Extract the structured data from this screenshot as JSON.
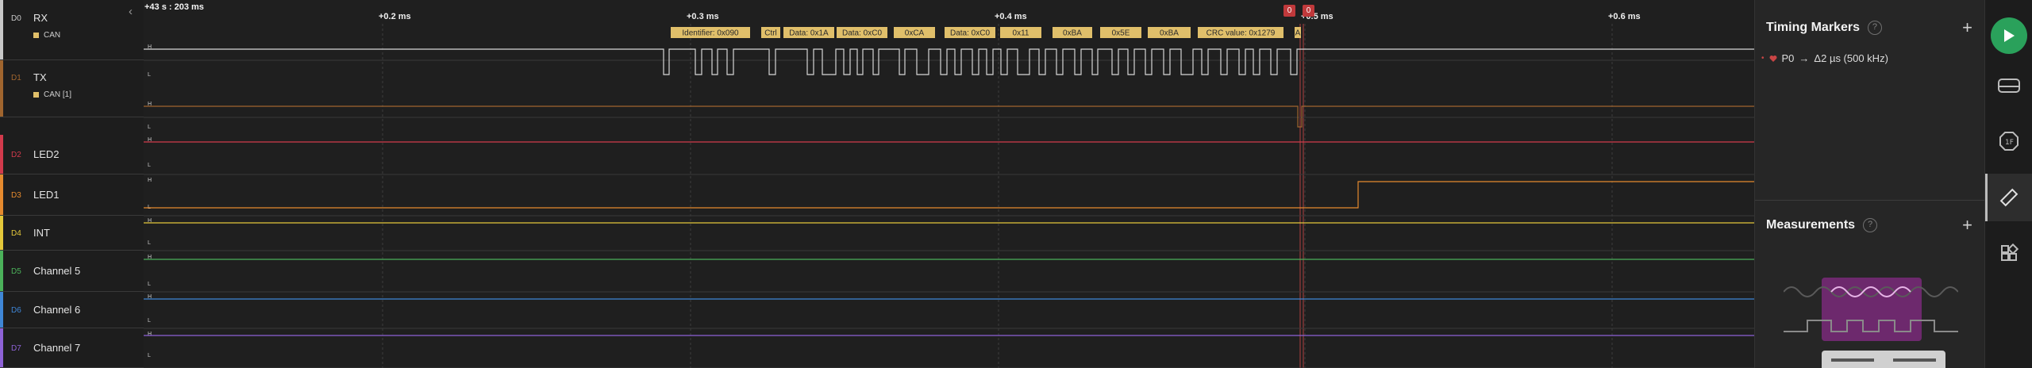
{
  "header": {
    "collapse_glyph": "‹",
    "time_origin": "+43 s : 203 ms",
    "ticks": [
      "+0.2 ms",
      "+0.3 ms",
      "+0.4 ms",
      "+0.5 ms",
      "+0.6 ms"
    ],
    "marker_flags": [
      "0",
      "0"
    ]
  },
  "channels": [
    {
      "id": "D0",
      "name": "RX",
      "analyzer": "CAN",
      "color": "#c8c8c8"
    },
    {
      "id": "D1",
      "name": "TX",
      "analyzer": "CAN [1]",
      "color": "#a0652e"
    },
    {
      "id": "D2",
      "name": "LED2",
      "analyzer": "",
      "color": "#d23a4c"
    },
    {
      "id": "D3",
      "name": "LED1",
      "analyzer": "",
      "color": "#e58a2e"
    },
    {
      "id": "D4",
      "name": "INT",
      "analyzer": "",
      "color": "#e4c83a"
    },
    {
      "id": "D5",
      "name": "Channel 5",
      "analyzer": "",
      "color": "#4bb15a"
    },
    {
      "id": "D6",
      "name": "Channel 6",
      "analyzer": "",
      "color": "#3f86d6"
    },
    {
      "id": "D7",
      "name": "Channel 7",
      "analyzer": "",
      "color": "#8e62d6"
    }
  ],
  "level_labels": {
    "high": "H",
    "low": "L"
  },
  "can_frames": [
    "Identifier: 0x090",
    "Ctrl",
    "Data: 0x1A",
    "Data: 0xC0",
    "0xCA",
    "Data: 0xC0",
    "0x11",
    "0xBA",
    "0x5E",
    "0xBA",
    "CRC value: 0x1279",
    "A"
  ],
  "timing_markers": {
    "title": "Timing Markers",
    "help": "?",
    "add": "+",
    "entries": [
      {
        "name": "P0",
        "arrow": "→",
        "value": "Δ2 µs (500 kHz)"
      }
    ]
  },
  "measurements": {
    "title": "Measurements",
    "help": "?",
    "add": "+"
  },
  "colors": {
    "accent": "#2aa15b",
    "frame_label": "#e0bf6a",
    "marker": "#c0393b"
  }
}
